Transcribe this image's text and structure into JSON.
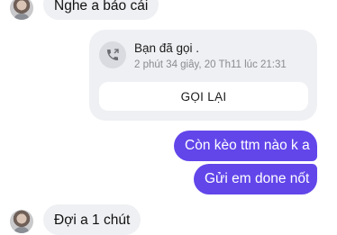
{
  "messages": {
    "incoming_top": "Nghe a bảo cái",
    "call_card": {
      "title": "Bạn đã gọi .",
      "subtitle": "2 phút 34 giây, 20 Th11 lúc 21:31",
      "button_label": "GỌI LẠI",
      "icon": "phone-icon"
    },
    "outgoing_1": "Còn kèo ttm nào k a",
    "outgoing_2": "Gửi em done nốt",
    "incoming_bottom": "Đợi a 1 chút"
  },
  "colors": {
    "outgoing_bubble": "#6246ea",
    "incoming_bubble": "#eff0f3"
  }
}
